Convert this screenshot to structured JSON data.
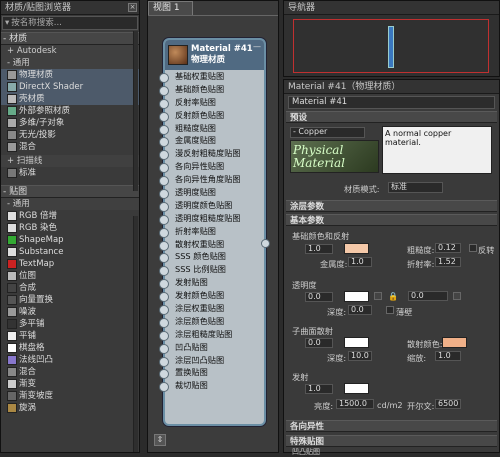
{
  "left": {
    "title": "材质/贴图浏览器",
    "search_placeholder": "按名称搜索...",
    "sections": {
      "materials": "- 材质",
      "autodesk": "+ Autodesk",
      "general": "- 通用",
      "scanline": "+ 扫描线",
      "standard": "标准",
      "maps": "- 贴图",
      "maps_general": "- 通用"
    },
    "materials": [
      "物理材质",
      "DirectX Shader",
      "壳材质",
      "外部参照材质",
      "多维/子对象",
      "无光/投影",
      "混合"
    ],
    "maps": [
      "RGB 倍增",
      "RGB 染色",
      "ShapeMap",
      "Substance",
      "TextMap",
      "位图",
      "合成",
      "向量置换",
      "噪波",
      "多平铺",
      "平铺",
      "棋盘格",
      "法线凹凸",
      "混合",
      "渐变",
      "渐变坡度",
      "旋涡"
    ]
  },
  "mid": {
    "tab": "视图 1",
    "node_title": "Material #41",
    "node_subtitle": "物理材质",
    "slots": [
      "基础权重贴图",
      "基础颜色贴图",
      "反射率贴图",
      "反射颜色贴图",
      "粗糙度贴图",
      "金属度贴图",
      "漫反射粗糙度贴图",
      "各向异性贴图",
      "各向异性角度贴图",
      "透明度贴图",
      "透明度颜色贴图",
      "透明度粗糙度贴图",
      "折射率贴图",
      "散射权重贴图",
      "SSS 颜色贴图",
      "SSS 比例贴图",
      "发射贴图",
      "发射颜色贴图",
      "涂层权重贴图",
      "涂层颜色贴图",
      "涂层粗糙度贴图",
      "凹凸贴图",
      "涂层凹凸贴图",
      "置换贴图",
      "裁切贴图"
    ]
  },
  "nav": {
    "title": "导航器"
  },
  "prop": {
    "title": "Material #41（物理材质）",
    "name": "Material #41",
    "presets": "预设",
    "preset_value": "- Copper",
    "preset_desc": "A normal copper material.",
    "thumb_text": "Physical Material",
    "mode_label": "材质模式:",
    "mode_value": "标准",
    "coat_params": "涂层参数",
    "basic_params": "基本参数",
    "base_color_label": "基础颜色和反射",
    "base_weight": "1.0",
    "roughness_label": "粗糙度:",
    "roughness": "0.12",
    "invert": "反转",
    "metalness_label": "金属度:",
    "metalness": "1.0",
    "ior_label": "折射率:",
    "ior": "1.52",
    "transparency": "透明度",
    "trans_weight": "0.0",
    "trans_rough": "0.0",
    "thin_walled": "薄壁",
    "depth_label": "深度:",
    "trans_depth": "0.0",
    "sss": "子曲面散射",
    "sss_weight": "0.0",
    "scatter_color": "散射颜色:",
    "sss_depth": "10.0",
    "scale_label": "缩放:",
    "sss_scale": "1.0",
    "emission": "发射",
    "em_weight": "1.0",
    "luminance_label": "亮度:",
    "luminance": "1500.0",
    "lum_unit": "cd/m2",
    "kelvin_label": "开尔文:",
    "kelvin": "6500",
    "anisotropy": "各向异性",
    "special_maps": "特殊贴图",
    "bump_map": "凹凸贴图"
  },
  "colors": {
    "base": "#f4c8a8",
    "scatter": "#f0b088",
    "accent": "#506a82"
  }
}
